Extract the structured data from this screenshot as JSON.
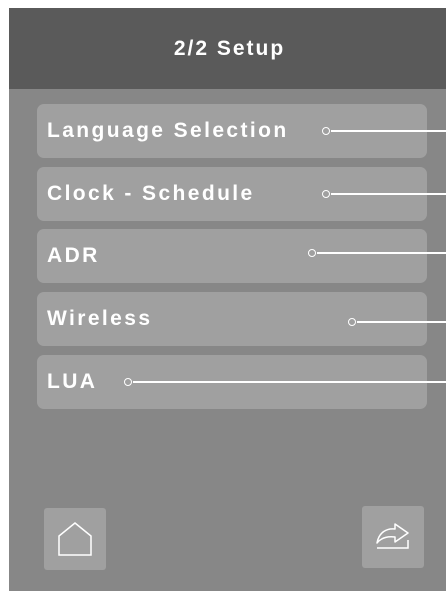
{
  "header": {
    "title": "2/2 Setup"
  },
  "menu": {
    "items": [
      {
        "label": "Language Selection"
      },
      {
        "label": "Clock - Schedule"
      },
      {
        "label": "ADR"
      },
      {
        "label": "Wireless"
      },
      {
        "label": "LUA"
      }
    ]
  },
  "footer": {
    "home_icon": "home-icon",
    "next_icon": "forward-arrow-icon"
  },
  "colors": {
    "header_bg": "#5a5a5a",
    "screen_bg": "#878787",
    "button_bg": "#a0a0a0",
    "text": "#ffffff"
  }
}
